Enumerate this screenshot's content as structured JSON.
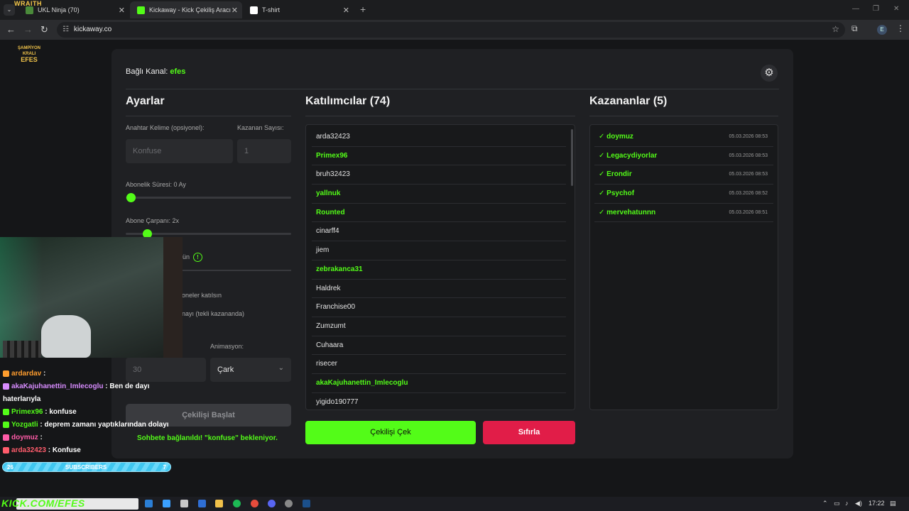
{
  "browser": {
    "wraith_label": "WRAITH",
    "tabs": [
      {
        "title": "UKL Ninja (70)",
        "favicon_color": "#4a8a3a"
      },
      {
        "title": "Kickaway - Kick Çekiliş Aracı",
        "favicon_color": "#53fc18"
      },
      {
        "title": "T-shirt",
        "favicon_color": "#ffffff"
      }
    ],
    "url": "kickaway.co",
    "profile_initial": "E"
  },
  "logo": {
    "line1": "ŞAMPİYON KRALI",
    "line2": "EFES"
  },
  "header": {
    "connected_label": "Bağlı Kanal:",
    "channel": "efes"
  },
  "settings": {
    "title": "Ayarlar",
    "keyword_label": "Anahtar Kelime (opsiyonel):",
    "keyword_placeholder": "Konfuse",
    "winner_count_label": "Kazanan Sayısı:",
    "winner_count_placeholder": "1",
    "sub_duration_label": "Abonelik Süresi: 0 Ay",
    "sub_duration_value": 0,
    "sub_multiplier_label": "Abone Çarpanı: 2x",
    "sub_multiplier_value": 0.13,
    "partial_label_a": "ün",
    "partial_label_b": "oneler katılsın",
    "partial_label_c": "nayı (tekli kazananda)",
    "duration_placeholder": "30",
    "animation_label": "Animasyon:",
    "animation_value": "Çark",
    "start_button": "Çekilişi Başlat",
    "status": "Sohbete bağlanıldı! \"konfuse\" bekleniyor."
  },
  "participants": {
    "title": "Katılımcılar (74)",
    "items": [
      {
        "name": "arda32423",
        "sub": false
      },
      {
        "name": "Primex96",
        "sub": true
      },
      {
        "name": "bruh32423",
        "sub": false
      },
      {
        "name": "yallnuk",
        "sub": true
      },
      {
        "name": "Rounted",
        "sub": true
      },
      {
        "name": "cinarff4",
        "sub": false
      },
      {
        "name": "jiem",
        "sub": false
      },
      {
        "name": "zebrakanca31",
        "sub": true
      },
      {
        "name": "Haldrek",
        "sub": false
      },
      {
        "name": "Franchise00",
        "sub": false
      },
      {
        "name": "Zumzumt",
        "sub": false
      },
      {
        "name": "Cuhaara",
        "sub": false
      },
      {
        "name": "risecer",
        "sub": false
      },
      {
        "name": "akaKajuhanettin_Imlecoglu",
        "sub": true
      },
      {
        "name": "yigido190777",
        "sub": false
      }
    ],
    "draw_button": "Çekilişi Çek",
    "reset_button": "Sıfırla"
  },
  "winners": {
    "title": "Kazananlar (5)",
    "items": [
      {
        "name": "✓ doymuz",
        "time": "05.03.2026 08:53"
      },
      {
        "name": "✓ Legacydiyorlar",
        "time": "05.03.2026 08:53"
      },
      {
        "name": "✓ Erondir",
        "time": "05.03.2026 08:53"
      },
      {
        "name": "✓ Psychof",
        "time": "05.03.2026 08:52"
      },
      {
        "name": "✓ mervehatunnn",
        "time": "05.03.2026 08:51"
      }
    ]
  },
  "chat": [
    {
      "user": "ardardav",
      "text": " : ",
      "user_color": "#ff9d2e"
    },
    {
      "user": "akaKajuhanettin_Imlecoglu",
      "text": " : Ben de dayı haterlarıyla",
      "user_color": "#d88cff"
    },
    {
      "user": "Primex96",
      "text": " : konfuse",
      "user_color": "#53fc18"
    },
    {
      "user": "Yozgatli",
      "text": " : deprem zamanı yaptıklarından dolayı",
      "user_color": "#53fc18"
    },
    {
      "user": "doymuz",
      "text": " : ",
      "user_color": "#ff5ca8"
    },
    {
      "user": "arda32423",
      "text": " : Konfuse",
      "user_color": "#ff5c6c"
    }
  ],
  "subscribers_bar": {
    "left": "26",
    "label": "SUBSCRIBERS",
    "right": "7"
  },
  "taskbar": {
    "kick_url": "KICK.COM/EFES",
    "clock": "17:22"
  }
}
